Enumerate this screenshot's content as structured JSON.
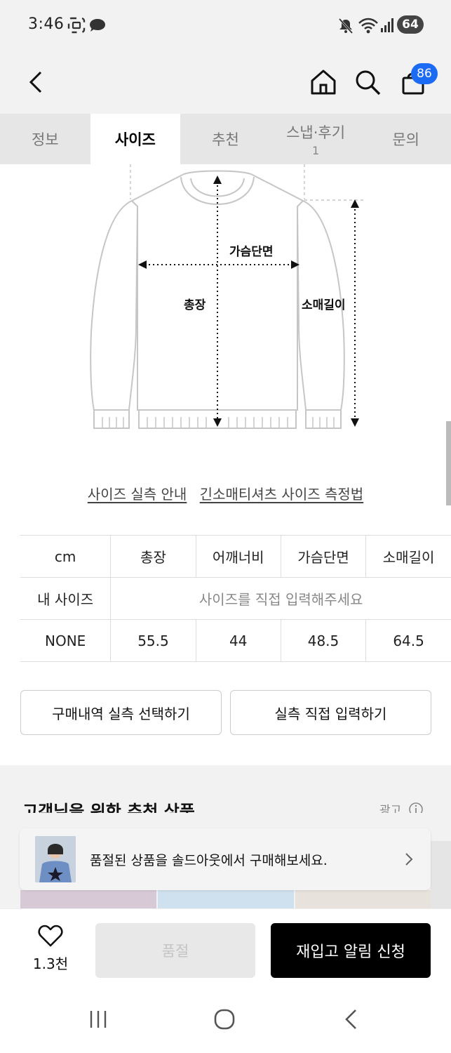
{
  "status_bar": {
    "time": "3:46",
    "battery": "64"
  },
  "header": {
    "cart_count": "86",
    "icons": [
      "back-icon",
      "home-icon",
      "search-icon",
      "bag-icon"
    ]
  },
  "tabs": [
    {
      "label": "정보",
      "count": ""
    },
    {
      "label": "사이즈",
      "count": ""
    },
    {
      "label": "추천",
      "count": ""
    },
    {
      "label": "스냅·후기",
      "count": "1"
    },
    {
      "label": "문의",
      "count": ""
    }
  ],
  "active_tab": "사이즈",
  "diagram": {
    "chest_label": "가슴단면",
    "length_label": "총장",
    "sleeve_label": "소매길이"
  },
  "links": {
    "size_guide": "사이즈 실측 안내",
    "measure_guide": "긴소매티셔츠 사이즈 측정법"
  },
  "size_table": {
    "headers": [
      "cm",
      "총장",
      "어깨너비",
      "가슴단면",
      "소매길이"
    ],
    "my_size_label": "내 사이즈",
    "my_size_placeholder": "사이즈를 직접 입력해주세요",
    "rows": [
      {
        "size": "NONE",
        "values": [
          "55.5",
          "44",
          "48.5",
          "64.5"
        ]
      }
    ]
  },
  "buttons": {
    "select_purchase": "구매내역 실측 선택하기",
    "direct_input": "실측 직접 입력하기"
  },
  "recommend": {
    "title": "고객님을 위한 추천 상품",
    "ad_label": "광고"
  },
  "toast": {
    "message": "품절된 상품을 솔드아웃에서 구매해보세요."
  },
  "bottom_bar": {
    "like_count": "1.3천",
    "soldout_label": "품절",
    "restock_label": "재입고 알림 신청"
  }
}
